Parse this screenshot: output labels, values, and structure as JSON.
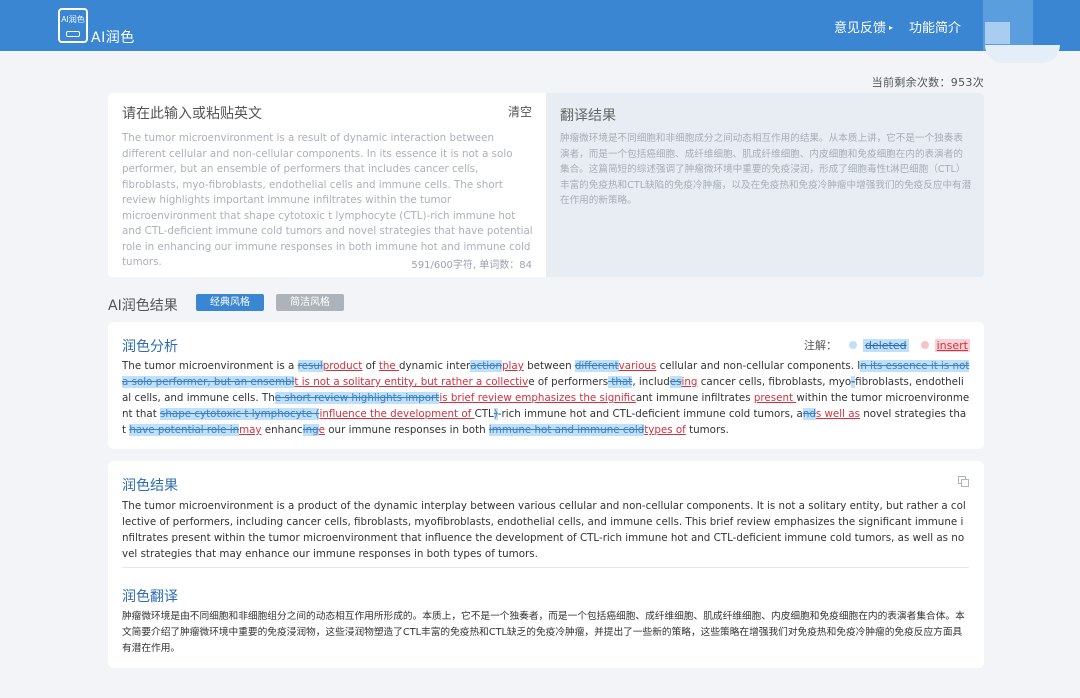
{
  "app": {
    "logo_mark": "AI润色",
    "name": "AI润色"
  },
  "nav": {
    "feedback": "意见反馈",
    "feedback_caret": "▸",
    "intro": "功能简介"
  },
  "remaining": {
    "label": "当前剩余次数：",
    "count": "953",
    "unit": "次"
  },
  "input": {
    "title": "请在此输入或粘贴英文",
    "clear": "清空",
    "text": "The tumor microenvironment is a result of dynamic interaction between different cellular and non-cellular components. In its essence it is not a solo performer, but an ensemble of performers that includes cancer cells, fibroblasts, myo-fibroblasts, endothelial cells and immune cells. The short review highlights important immune infiltrates within the tumor microenvironment that shape cytotoxic t lymphocyte (CTL)-rich immune hot and CTL-deficient immune cold tumors and novel strategies that have potential role in enhancing our immune responses in both immune hot and immune cold tumors.",
    "counter": "591/600字符, 单词数：84"
  },
  "translation_panel": {
    "title": "翻译结果",
    "text": "肿瘤微环境是不同细胞和非细胞成分之间动态相互作用的结果。从本质上讲，它不是一个独奏表演者，而是一个包括癌细胞、成纤维细胞、肌成纤维细胞、内皮细胞和免疫细胞在内的表演者的集合。这篇简短的综述强调了肿瘤微环境中重要的免疫浸润，形成了细胞毒性t淋巴细胞（CTL）丰富的免疫热和CTL缺陷的免疫冷肿瘤，以及在免疫热和免疫冷肿瘤中增强我们的免疫反应中有潜在作用的新策略。"
  },
  "result_section": {
    "label": "AI润色结果",
    "style_classic": "经典风格",
    "style_simple": "简洁风格"
  },
  "analysis": {
    "title": "润色分析",
    "legend_label": "注解：",
    "legend_deleted": "deleted",
    "legend_insert": "insert",
    "segments": [
      {
        "t": "The tumor microenvironment is a ",
        "k": "n"
      },
      {
        "t": "resul",
        "k": "d"
      },
      {
        "t": "product",
        "k": "i"
      },
      {
        "t": " of ",
        "k": "n"
      },
      {
        "t": "the ",
        "k": "i"
      },
      {
        "t": "dynamic inter",
        "k": "n"
      },
      {
        "t": "action",
        "k": "d"
      },
      {
        "t": "play",
        "k": "i"
      },
      {
        "t": " between ",
        "k": "n"
      },
      {
        "t": "different",
        "k": "d"
      },
      {
        "t": "various",
        "k": "i"
      },
      {
        "t": " cellular and non-cellular components. I",
        "k": "n"
      },
      {
        "t": "n its essence it is not a solo performer, but an ensembl",
        "k": "d"
      },
      {
        "t": "t is not a solitary entity, but rather a collectiv",
        "k": "i"
      },
      {
        "t": "e of performers",
        "k": "n"
      },
      {
        "t": " that",
        "k": "d"
      },
      {
        "t": ", includ",
        "k": "n"
      },
      {
        "t": "es",
        "k": "d"
      },
      {
        "t": "ing",
        "k": "i"
      },
      {
        "t": " cancer cells, fibroblasts, myo",
        "k": "n"
      },
      {
        "t": "-",
        "k": "d"
      },
      {
        "t": "fibroblasts, endothelial cells, and immune cells. Th",
        "k": "n"
      },
      {
        "t": "e short review highlights import",
        "k": "d"
      },
      {
        "t": "is brief review emphasizes the signific",
        "k": "i"
      },
      {
        "t": "ant immune infiltrates ",
        "k": "n"
      },
      {
        "t": "present ",
        "k": "i"
      },
      {
        "t": "within the tumor microenvironment that ",
        "k": "n"
      },
      {
        "t": "shape cytotoxic t lymphocyte (",
        "k": "d"
      },
      {
        "t": "influence the development of ",
        "k": "i"
      },
      {
        "t": "CTL",
        "k": "n"
      },
      {
        "t": ")",
        "k": "d"
      },
      {
        "t": "-rich immune hot and CTL-deficient immune cold tumors, a",
        "k": "n"
      },
      {
        "t": "nd",
        "k": "d"
      },
      {
        "t": "s well as",
        "k": "i"
      },
      {
        "t": " novel strategies that ",
        "k": "n"
      },
      {
        "t": "have potential role in",
        "k": "d"
      },
      {
        "t": "may",
        "k": "i"
      },
      {
        "t": " enhanc",
        "k": "n"
      },
      {
        "t": "ing",
        "k": "d"
      },
      {
        "t": "e",
        "k": "i"
      },
      {
        "t": " our immune responses in both ",
        "k": "n"
      },
      {
        "t": "immune hot and immune cold",
        "k": "d"
      },
      {
        "t": "types of",
        "k": "i"
      },
      {
        "t": " tumors.",
        "k": "n"
      }
    ]
  },
  "polished": {
    "title": "润色结果",
    "text": "The tumor microenvironment is a product of the dynamic interplay between various cellular and non-cellular components. It is not a solitary entity, but rather a collective of performers, including cancer cells, fibroblasts, myofibroblasts, endothelial cells, and immune cells. This brief review emphasizes the significant immune infiltrates present within the tumor microenvironment that influence the development of CTL-rich immune hot and CTL-deficient immune cold tumors, as well as novel strategies that may enhance our immune responses in both types of tumors."
  },
  "polished_translation": {
    "title": "润色翻译",
    "text": "肿瘤微环境是由不同细胞和非细胞组分之间的动态相互作用所形成的。本质上，它不是一个独奏者，而是一个包括癌细胞、成纤维细胞、肌成纤维细胞、内皮细胞和免疫细胞在内的表演者集合体。本文简要介绍了肿瘤微环境中重要的免疫浸润物，这些浸润物塑造了CTL丰富的免疫热和CTL缺乏的免疫冷肿瘤，并提出了一些新的策略，这些策略在增强我们对免疫热和免疫冷肿瘤的免疫反应方面具有潜在作用。"
  },
  "icons": {
    "copy": "copy-icon",
    "logo": "robot-logo-icon"
  },
  "colors": {
    "header": "#3a86d2",
    "accent": "#2e6db4",
    "deleted_bg": "#bfe0f7",
    "insert_text": "#d6303e"
  }
}
